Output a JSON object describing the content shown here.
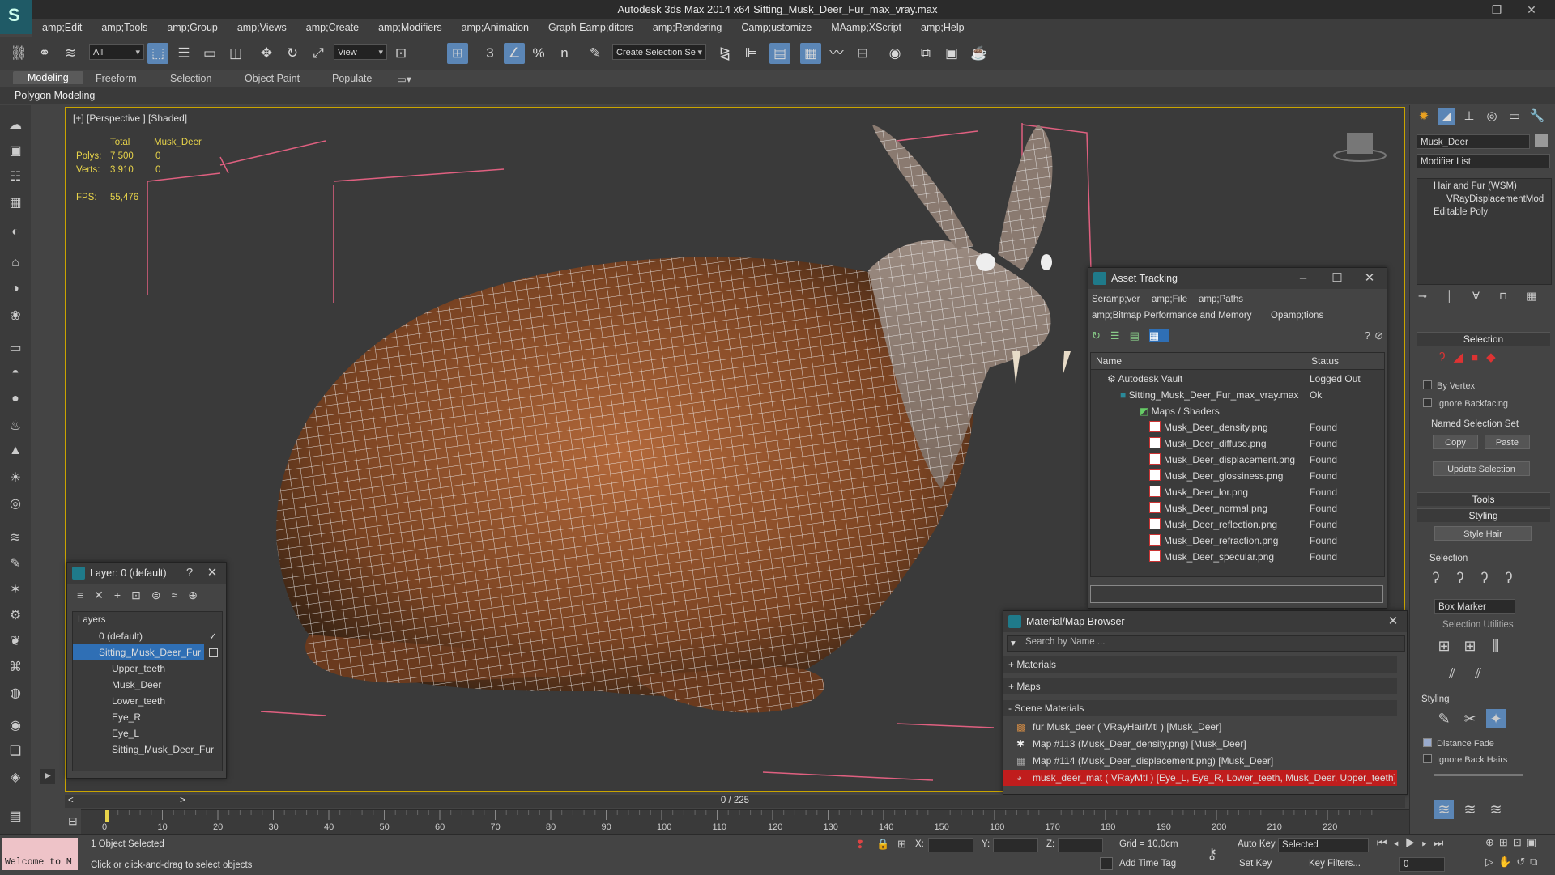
{
  "window": {
    "title": "Autodesk 3ds Max  2014 x64     Sitting_Musk_Deer_Fur_max_vray.max"
  },
  "menu": [
    "amp;Edit",
    "amp;Tools",
    "amp;Group",
    "amp;Views",
    "amp;Create",
    "amp;Modifiers",
    "amp;Animation",
    "Graph Eamp;ditors",
    "amp;Rendering",
    "Camp;ustomize",
    "MAamp;XScript",
    "amp;Help"
  ],
  "toolbar": {
    "filter_select": "All",
    "view_select": "View",
    "selection_set": "Create Selection Se",
    "snap_3": "3",
    "snap_pct": "%",
    "snap_dot": "n"
  },
  "ribbon": {
    "tabs": [
      "Modeling",
      "Freeform",
      "Selection",
      "Object Paint",
      "Populate"
    ],
    "sub": "Polygon Modeling"
  },
  "viewport": {
    "label": "[+] [Perspective ] [Shaded]",
    "stats": {
      "total_header": "Total",
      "obj_header": "Musk_Deer",
      "polys_label": "Polys:",
      "polys_total": "7 500",
      "polys_obj": "0",
      "verts_label": "Verts:",
      "verts_total": "3 910",
      "verts_obj": "0",
      "fps_label": "FPS:",
      "fps_value": "55,476"
    }
  },
  "layer_dialog": {
    "title": "Layer: 0 (default)",
    "help": "?",
    "header": "Layers",
    "rows": [
      "0 (default)",
      "Sitting_Musk_Deer_Fur",
      "Upper_teeth",
      "Musk_Deer",
      "Lower_teeth",
      "Eye_R",
      "Eye_L",
      "Sitting_Musk_Deer_Fur"
    ]
  },
  "asset_tracking": {
    "title": "Asset Tracking",
    "menus": [
      "Seramp;ver",
      "amp;File",
      "amp;Paths",
      "amp;Bitmap Performance and Memory",
      "Opamp;tions"
    ],
    "col_name": "Name",
    "col_status": "Status",
    "vault": {
      "name": "Autodesk Vault",
      "status": "Logged Out"
    },
    "file": {
      "name": "Sitting_Musk_Deer_Fur_max_vray.max",
      "status": "Ok"
    },
    "folder": "Maps / Shaders",
    "maps": [
      {
        "name": "Musk_Deer_density.png",
        "status": "Found"
      },
      {
        "name": "Musk_Deer_diffuse.png",
        "status": "Found"
      },
      {
        "name": "Musk_Deer_displacement.png",
        "status": "Found"
      },
      {
        "name": "Musk_Deer_glossiness.png",
        "status": "Found"
      },
      {
        "name": "Musk_Deer_lor.png",
        "status": "Found"
      },
      {
        "name": "Musk_Deer_normal.png",
        "status": "Found"
      },
      {
        "name": "Musk_Deer_reflection.png",
        "status": "Found"
      },
      {
        "name": "Musk_Deer_refraction.png",
        "status": "Found"
      },
      {
        "name": "Musk_Deer_specular.png",
        "status": "Found"
      }
    ]
  },
  "material_browser": {
    "title": "Material/Map Browser",
    "search_placeholder": "Search by Name ...",
    "groups": [
      "+ Materials",
      "+ Maps",
      "- Scene Materials"
    ],
    "items": [
      "fur Musk_deer  ( VRayHairMtl )  [Musk_Deer]",
      "Map #113 (Musk_Deer_density.png)  [Musk_Deer]",
      "Map #114 (Musk_Deer_displacement.png)  [Musk_Deer]",
      "musk_deer_mat  ( VRayMtl )  [Eye_L, Eye_R, Lower_teeth, Musk_Deer, Upper_teeth]"
    ]
  },
  "command_panel": {
    "object_name": "Musk_Deer",
    "modifier_list": "Modifier List",
    "stack": [
      "Hair and Fur (WSM)",
      "VRayDisplacementMod",
      "Editable Poly"
    ],
    "selection_head": "Selection",
    "by_vertex": "By Vertex",
    "ignore_backfacing": "Ignore Backfacing",
    "named_sel": "Named Selection Set",
    "copy": "Copy",
    "paste": "Paste",
    "update_selection": "Update Selection",
    "tools_head": "Tools",
    "styling_head": "Styling",
    "style_hair": "Style Hair",
    "selection_sub": "Selection",
    "box_marker": "Box Marker",
    "selection_utilities": "Selection Utilities",
    "styling_sub": "Styling",
    "distance_fade": "Distance Fade",
    "ignore_back_hairs": "Ignore Back Hairs"
  },
  "timeline": {
    "position": "0 / 225",
    "ticks": [
      "0",
      "10",
      "20",
      "30",
      "40",
      "50",
      "60",
      "70",
      "80",
      "90",
      "100",
      "110",
      "120",
      "130",
      "140",
      "150",
      "160",
      "170",
      "180",
      "190",
      "200",
      "210",
      "220"
    ]
  },
  "status": {
    "maxscript": "Welcome to M",
    "objects": "1 Object Selected",
    "prompt": "Click or click-and-drag to select objects",
    "x_label": "X:",
    "y_label": "Y:",
    "z_label": "Z:",
    "grid": "Grid = 10,0cm",
    "auto_key": "Auto Key",
    "selected": "Selected",
    "set_key": "Set Key",
    "key_filters": "Key Filters...",
    "add_time_tag": "Add Time Tag",
    "frame": "0"
  }
}
